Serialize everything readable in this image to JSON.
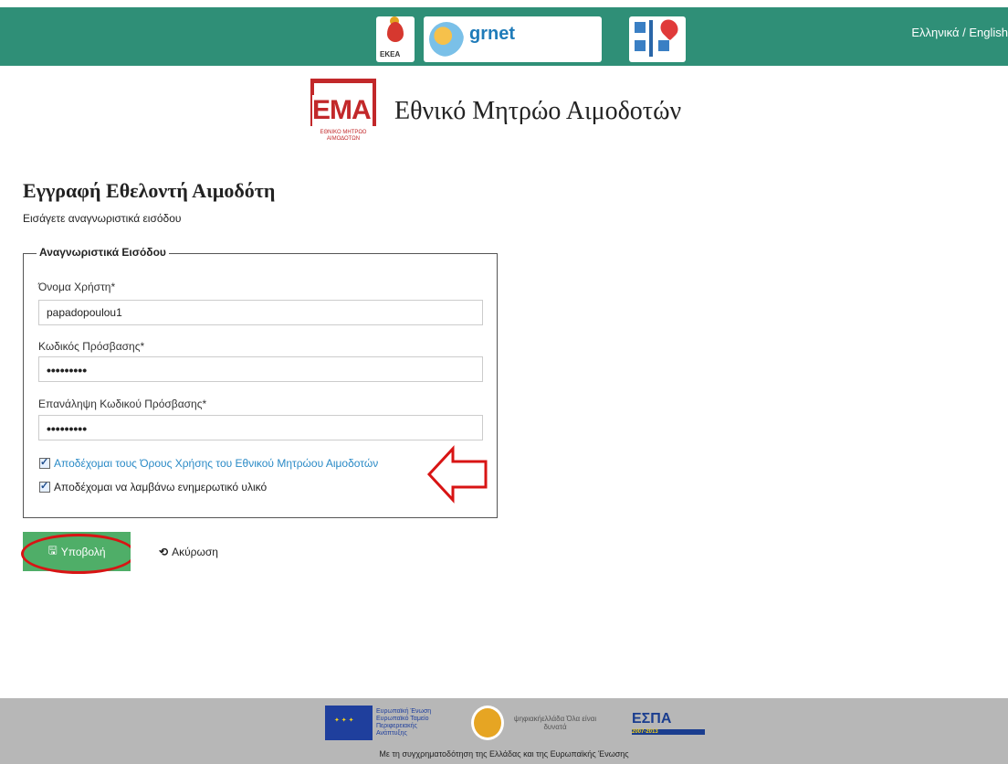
{
  "header": {
    "language_switch": "Ελληνικά / English",
    "logos": [
      "ekea-logo",
      "grnet-logo",
      "medical-logo"
    ],
    "grnet_text": "grnet",
    "ekea_text": "ΕΚΕΑ"
  },
  "branding": {
    "logo_word": "ΕΜΑ",
    "logo_subtext": "ΕΘΝΙΚΟ ΜΗΤΡΩΟ ΑΙΜΟΔΟΤΩΝ",
    "site_title": "Εθνικό Μητρώο Αιμοδοτών"
  },
  "page": {
    "heading": "Εγγραφή Εθελοντή Αιμοδότη",
    "subheading": "Εισάγετε αναγνωριστικά εισόδου"
  },
  "form": {
    "legend": "Αναγνωριστικά Εισόδου",
    "username_label": "Όνομα Χρήστη*",
    "username_value": "papadopoulou1",
    "password_label": "Κωδικός Πρόσβασης*",
    "password_value": "•••••••••",
    "password_repeat_label": "Επανάληψη Κωδικού Πρόσβασης*",
    "password_repeat_value": "•••••••••",
    "terms_label": "Αποδέχομαι τους Όρους Χρήσης του Εθνικού Μητρώου Αιμοδοτών",
    "terms_checked": true,
    "newsletter_label": "Αποδέχομαι να λαμβάνω ενημερωτικό υλικό",
    "newsletter_checked": true
  },
  "buttons": {
    "submit_label": "Υποβολή",
    "cancel_label": "Ακύρωση"
  },
  "footer": {
    "eu_text": "Ευρωπαϊκή Ένωση Ευρωπαϊκό Ταμείο Περιφερειακής Ανάπτυξης",
    "digital_text": "ψηφιακήελλάδα Όλα είναι δυνατά",
    "espa_text": "ΕΣΠΑ",
    "espa_years": "2007-2013",
    "cofunding_text": "Με τη συγχρηματοδότηση της Ελλάδας και της Ευρωπαϊκής Ένωσης"
  },
  "colors": {
    "header_bg": "#2f8f77",
    "brand_red": "#c2282a",
    "submit_green": "#4fae68",
    "link_blue": "#2a8ac6",
    "annotation_red": "#d81414",
    "footer_bg": "#b7b7b7"
  }
}
